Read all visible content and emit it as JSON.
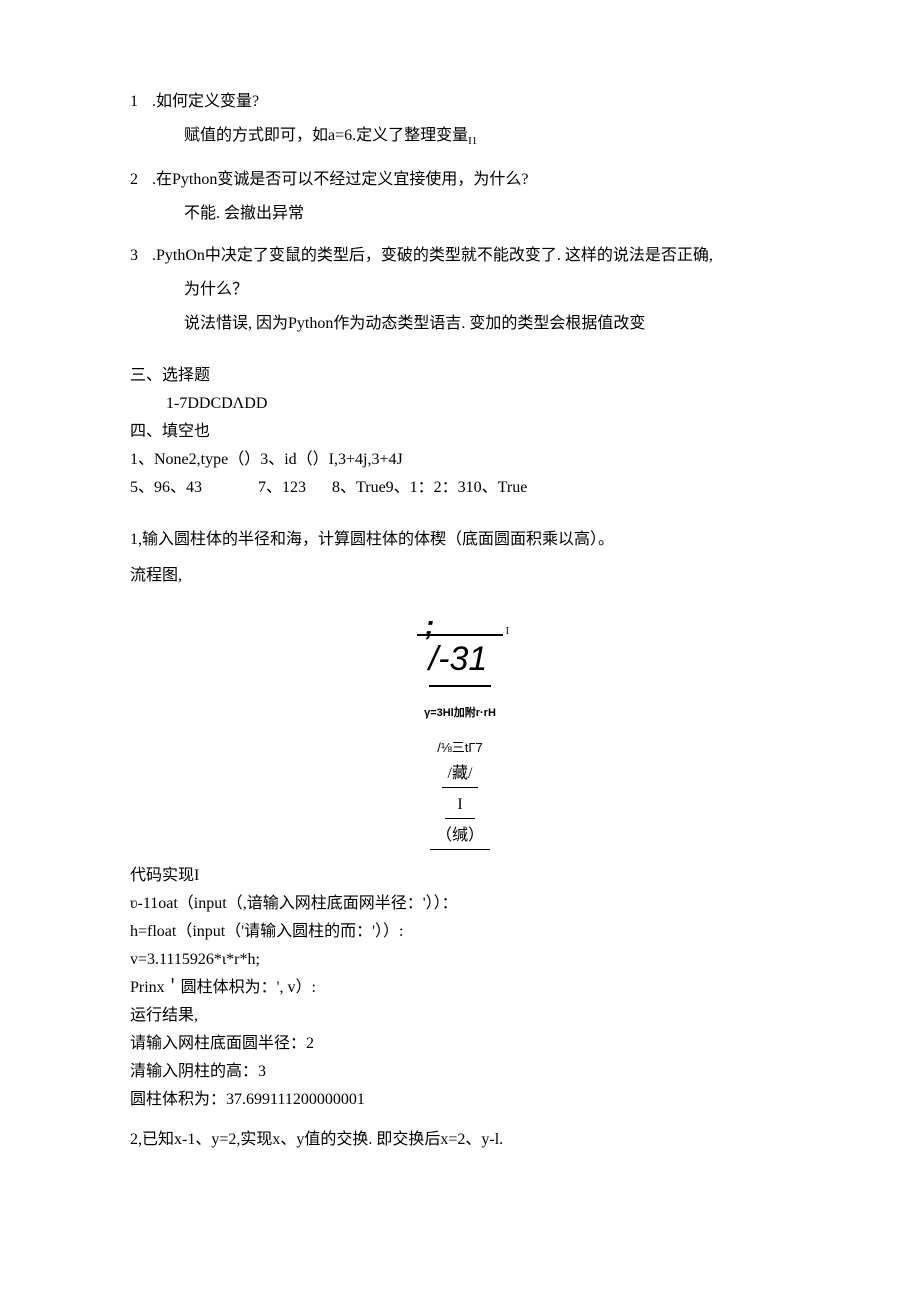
{
  "q1": {
    "num": "1",
    "text": ".如何定义变量?",
    "ans": "赋值的方式即可，如a=6.定义了整理变量",
    "ans_sub": "I1"
  },
  "q2": {
    "num": "2",
    "text": ".在Python变诚是否可以不经过定义宜接使用，为什么?",
    "ans": "不能. 会撤出异常"
  },
  "q3": {
    "num": "3",
    "text": ".PythOn中决定了变鼠的类型后，变破的类型就不能改变了. 这样的说法是否正确,",
    "ans1": "为什么？",
    "ans2": "说法惜误, 因为Python作为动态类型语吉. 变加的类型会根据值改变"
  },
  "sec3": {
    "head": "三、选择题",
    "line": "1-7DDCDΛDD"
  },
  "sec4": {
    "head": "四、填空也",
    "l1": "1、None2,type（）3、id（）I,3+4j,3+4J",
    "l2a": "5、96、43",
    "l2b": "7、123",
    "l2c": "8、True9、1：2：310、True"
  },
  "prog": {
    "p1": "1,输入圆柱体的半径和海，计算圆柱体的体稧（底面圆面积乘以高）。",
    "p2": "流程图,"
  },
  "diagram": {
    "semi": ";",
    "tick": "I",
    "big": "/-31",
    "formula": "γ=3Hl加附r·rH",
    "mid": "/⅛三tΓ7",
    "box1": "/藏/",
    "i": "I",
    "box2": "（缄）"
  },
  "code": {
    "head": "代码实现I",
    "l1": "ʋ-11oat（input（,谙输入网柱底面网半径：'））：",
    "l2": "h=float（input（'请输入圆柱的而：'））:",
    "l3": "v=3.1115926*ι*r*h;",
    "l4": "Prinx＇圆柱体枳为：',  v）:",
    "res_head": "运行结果,",
    "r1": "请输入网柱底面圆半径：2",
    "r2": "清输入阴柱的高：3",
    "r3": "圆柱体积为：37.699111200000001"
  },
  "final": "2,已知x-1、y=2,实现x、y值的交换. 即交换后x=2、y-l."
}
